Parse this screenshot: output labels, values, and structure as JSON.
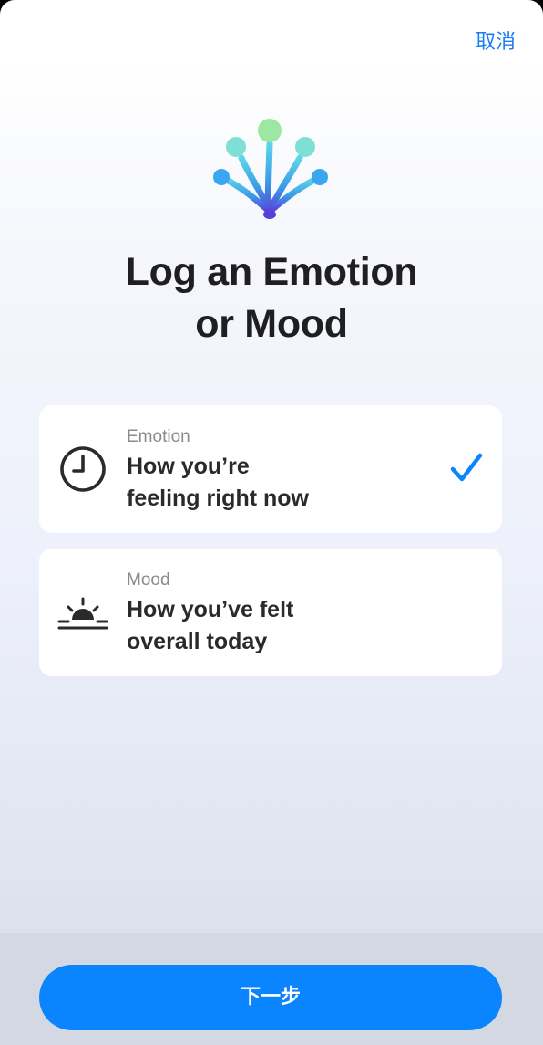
{
  "header": {
    "cancel_label": "取消"
  },
  "hero": {
    "icon": "state-of-mind-icon",
    "title_line1": "Log an Emotion",
    "title_line2": "or Mood"
  },
  "options": [
    {
      "label": "Emotion",
      "description_line1": "How you’re",
      "description_line2": "feeling right now",
      "icon": "clock-icon",
      "selected": true
    },
    {
      "label": "Mood",
      "description_line1": "How you’ve felt",
      "description_line2": "overall today",
      "icon": "sunrise-icon",
      "selected": false
    }
  ],
  "footer": {
    "next_label": "下一步"
  },
  "colors": {
    "accent": "#0a84ff",
    "link": "#1a7ef0",
    "title": "#1f1f22"
  }
}
